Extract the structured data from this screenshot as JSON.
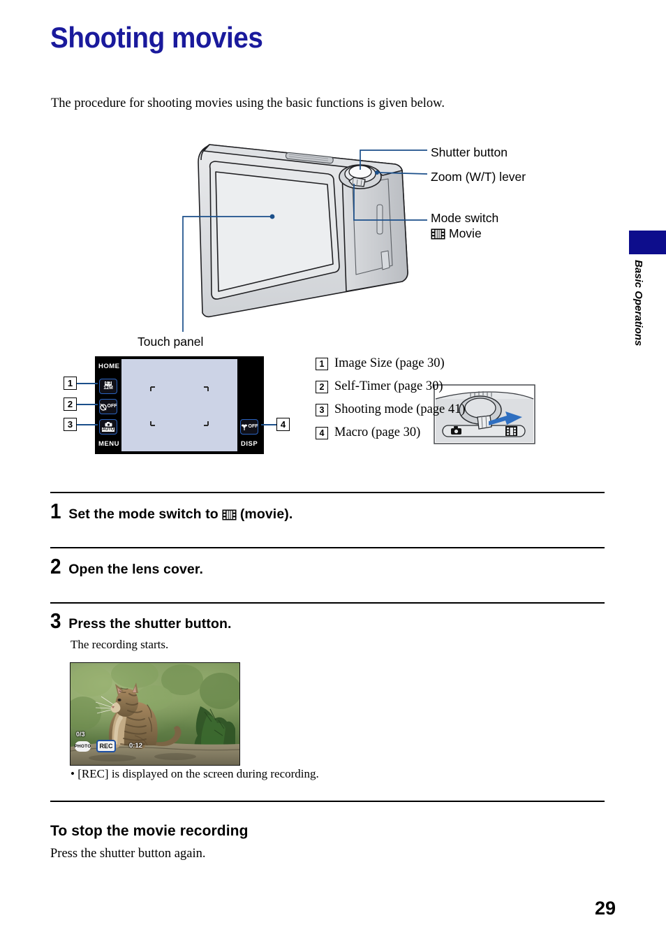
{
  "page": {
    "title": "Shooting movies",
    "intro": "The procedure for shooting movies using the basic functions is given below.",
    "side_tab": "Basic Operations",
    "page_number": "29",
    "title_color": "#1a1a9c",
    "tab_color": "#0d0d8c",
    "leader_color": "#1b4f8a"
  },
  "figure": {
    "labels": {
      "shutter_button": "Shutter button",
      "zoom_lever": "Zoom (W/T) lever",
      "mode_switch": "Mode switch",
      "movie": "Movie",
      "touch_panel": "Touch panel"
    },
    "movie_icon": "film-strip-icon",
    "mode_inset": {
      "left_icon": "camera-icon",
      "right_icon": "film-strip-icon",
      "arrow": "arrow-right-icon"
    }
  },
  "lcd": {
    "home": "HOME",
    "menu": "MENU",
    "disp": "DISP",
    "buttons": [
      {
        "num": "1",
        "icon": "image-size-icon",
        "top": "4:3",
        "bottom": "12M"
      },
      {
        "num": "2",
        "icon": "self-timer-icon",
        "label": "OFF"
      },
      {
        "num": "3",
        "icon": "shooting-mode-icon",
        "label": "AUTO"
      },
      {
        "num": "4",
        "icon": "macro-icon",
        "label": "OFF"
      }
    ]
  },
  "key_list": [
    {
      "num": "1",
      "text": "Image Size (page 30)"
    },
    {
      "num": "2",
      "text": "Self-Timer (page 30)"
    },
    {
      "num": "3",
      "text": "Shooting mode (page 41)"
    },
    {
      "num": "4",
      "text": "Macro (page 30)"
    }
  ],
  "steps": [
    {
      "num": "1",
      "before": "Set the mode switch to",
      "icon": "film-strip-icon",
      "after": "(movie)."
    },
    {
      "num": "2",
      "before": "Open the lens cover.",
      "icon": "",
      "after": ""
    },
    {
      "num": "3",
      "before": "Press the shutter button.",
      "icon": "",
      "after": ""
    }
  ],
  "step3": {
    "note": "The recording starts.",
    "bullet": "• [REC] is displayed on the screen during recording.",
    "photo_alt": "tabby-cat-photo",
    "overlays": {
      "counter": "0/3",
      "photo_button": "PHOTO",
      "rec_indicator": "REC",
      "elapsed_time": "0:12"
    }
  },
  "stop_section": {
    "heading": "To stop the movie recording",
    "body": "Press the shutter button again."
  }
}
